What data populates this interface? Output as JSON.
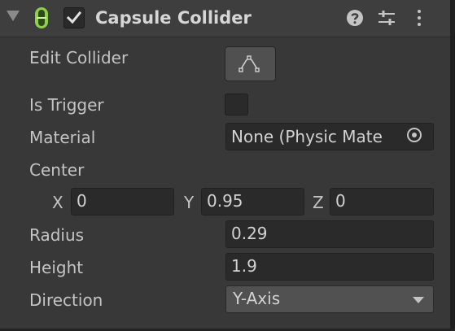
{
  "component": {
    "title": "Capsule Collider",
    "enabled": true,
    "icons": [
      "foldout-arrow-icon",
      "capsule-collider-icon",
      "help-icon",
      "preset-icon",
      "kebab-menu-icon"
    ]
  },
  "fields": {
    "edit_collider": {
      "label": "Edit Collider",
      "button_icon": "edit-collider-icon"
    },
    "is_trigger": {
      "label": "Is Trigger",
      "checked": false
    },
    "material": {
      "label": "Material",
      "value": "None (Physic Mate",
      "picker_icon": "object-picker-icon"
    },
    "center": {
      "label": "Center",
      "x_label": "X",
      "x": "0",
      "y_label": "Y",
      "y": "0.95",
      "z_label": "Z",
      "z": "0"
    },
    "radius": {
      "label": "Radius",
      "value": "0.29"
    },
    "height": {
      "label": "Height",
      "value": "1.9"
    },
    "direction": {
      "label": "Direction",
      "value": "Y-Axis"
    }
  },
  "colors": {
    "background": "#383838",
    "header": "#3e3e3e",
    "field": "#2a2a2a",
    "button": "#505050",
    "capsule_icon": "#8dd14a",
    "text": "#c4c4c4"
  }
}
